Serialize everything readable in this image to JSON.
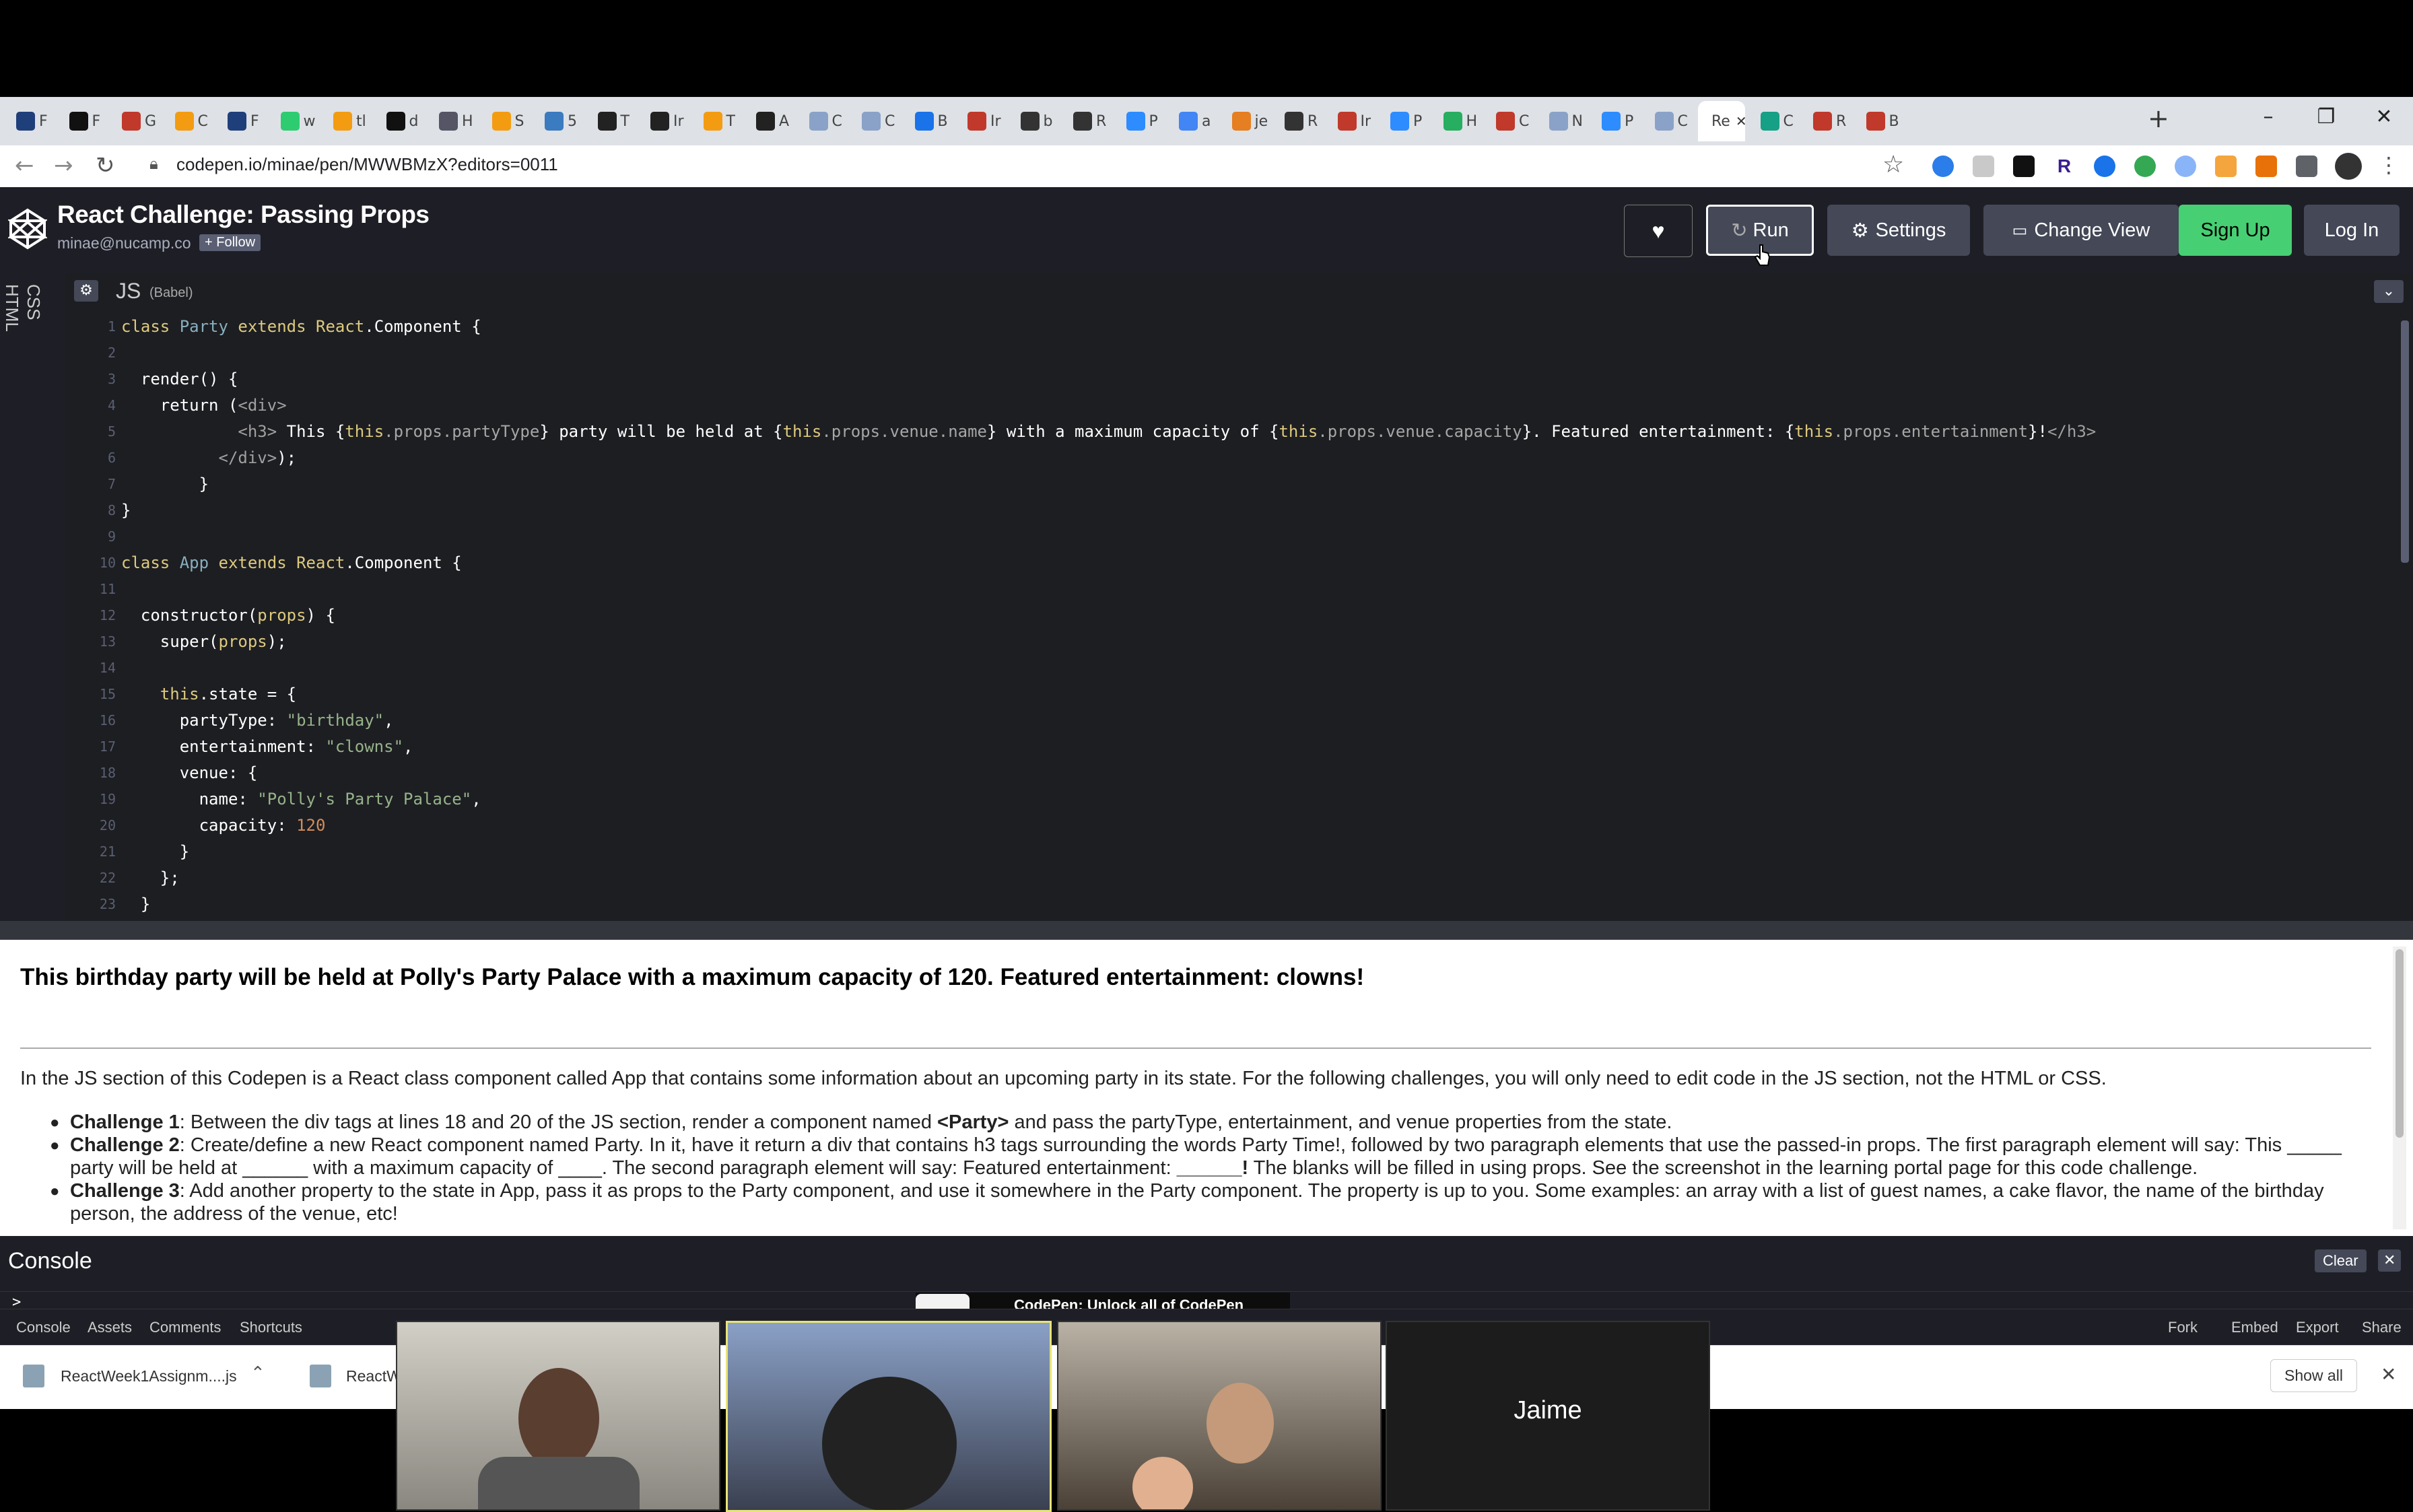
{
  "browser": {
    "tabs": [
      "F",
      "F",
      "G",
      "C",
      "F",
      "w",
      "tl",
      "d",
      "H",
      "S",
      "5",
      "T",
      "Ir",
      "T",
      "A",
      "C",
      "C",
      "B",
      "Ir",
      "b",
      "R",
      "P",
      "a",
      "je",
      "R",
      "Ir",
      "P",
      "H",
      "C",
      "N",
      "P",
      "C",
      "Re",
      "C",
      "R",
      "B"
    ],
    "active_tab_index": 32,
    "new_tab": "+",
    "window_controls": [
      "–",
      "❐",
      "✕"
    ],
    "url": "codepen.io/minae/pen/MWWBMzX?editors=0011"
  },
  "codepen": {
    "title": "React Challenge: Passing Props",
    "user": "minae@nucamp.co",
    "follow": "+ Follow",
    "buttons": {
      "run": "Run",
      "settings": "Settings",
      "change_view": "Change View",
      "sign_up": "Sign Up",
      "log_in": "Log In"
    },
    "side_tabs": {
      "css": "CSS",
      "html": "HTML"
    },
    "editor": {
      "name": "JS",
      "mode": "(Babel)"
    },
    "line_numbers": [
      "1",
      "2",
      "3",
      "4",
      "5",
      "6",
      "7",
      "8",
      "9",
      "10",
      "11",
      "12",
      "13",
      "14",
      "15",
      "16",
      "17",
      "18",
      "19",
      "20",
      "21",
      "22",
      "23"
    ]
  },
  "code": {
    "l1": [
      "class ",
      "Party ",
      "extends ",
      "React",
      ".Component {"
    ],
    "l3": [
      "  render() {"
    ],
    "l4": [
      "    return (",
      "<div>"
    ],
    "l5": [
      "            ",
      "<h3>",
      " This {",
      "this",
      ".props.partyType",
      "} party will be held at {",
      "this",
      ".props.venue.name",
      "} with a maximum capacity of {",
      "this",
      ".props.venue.capacity",
      "}. Featured entertainment: {",
      "this",
      ".props.entertainment",
      "}!",
      "</h3>"
    ],
    "l6": [
      "          ",
      "</div>",
      ");"
    ],
    "l7": [
      "        }"
    ],
    "l8": [
      "}"
    ],
    "l10": [
      "class ",
      "App ",
      "extends ",
      "React",
      ".Component {"
    ],
    "l12": [
      "  constructor(",
      "props",
      ") {"
    ],
    "l13": [
      "    super(",
      "props",
      ");"
    ],
    "l15": [
      "    this",
      ".state = {"
    ],
    "l16": [
      "      partyType: ",
      "\"birthday\"",
      ","
    ],
    "l17": [
      "      entertainment: ",
      "\"clowns\"",
      ","
    ],
    "l18": [
      "      venue: {"
    ],
    "l19": [
      "        name: ",
      "\"Polly's Party Palace\"",
      ","
    ],
    "l20": [
      "        capacity: ",
      "120"
    ],
    "l21": [
      "      }"
    ],
    "l22": [
      "    };"
    ],
    "l23": [
      "  }"
    ]
  },
  "preview": {
    "heading": "This birthday party will be held at Polly's Party Palace with a maximum capacity of 120. Featured entertainment: clowns!",
    "intro": "In the JS section of this Codepen is a React class component called App that contains some information about an upcoming party in its state. For the following challenges, you will only need to edit code in the JS section, not the HTML or CSS.",
    "c1_label": "Challenge 1",
    "c1_a": ": Between the div tags at lines 18 and 20 of the JS section, render a component named ",
    "c1_tag": "<Party>",
    "c1_b": " and pass the partyType, entertainment, and venue properties from the state.",
    "c2_label": "Challenge 2",
    "c2_a": ": Create/define a new React component named Party. In it, have it return a div that contains h3 tags surrounding the words Party Time!, followed by two paragraph elements that use the passed-in props. The first paragraph element will say: This _____ party will be held at ______ with a maximum capacity of ____. The second paragraph element will say: Featured entertainment: ",
    "c2_blank": "______!",
    "c2_b": " The blanks will be filled in using props. See the screenshot in the learning portal page for this code challenge.",
    "c3_label": "Challenge 3",
    "c3_a": ": Add another property to the state in App, pass it as props to the Party component, and use it somewhere in the Party component. The property is up to you. Some examples: an array with a list of guest names, a cake flavor, the name of the birthday person, the address of the venue, etc!"
  },
  "console": {
    "title": "Console",
    "clear": "Clear",
    "close": "✕",
    "prompt": ">",
    "banner": "CodePen: Unlock all of CodePen"
  },
  "footer": {
    "left": [
      "Console",
      "Assets",
      "Comments",
      "Shortcuts"
    ],
    "right": [
      "Fork",
      "Embed",
      "Export",
      "Share"
    ]
  },
  "downloads": {
    "file1": "ReactWeek1Assignm....js",
    "file2": "ReactW",
    "show_all": "Show all",
    "close": "✕"
  },
  "video": {
    "participant4": "Jaime"
  },
  "colors": {
    "brand_green": "#47cf73",
    "header_bg": "#1e1f26",
    "editor_bg": "#1d1e22"
  }
}
